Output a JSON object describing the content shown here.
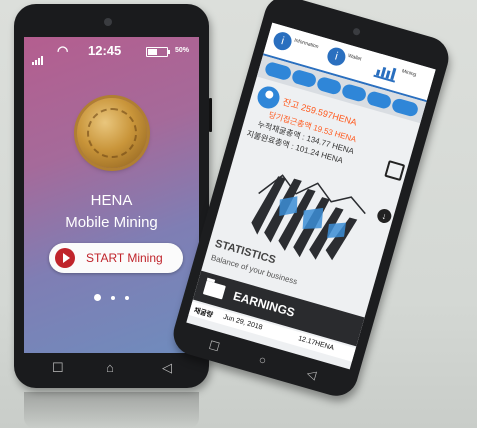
{
  "phone1": {
    "status": {
      "time": "12:45",
      "battery_pct": "50%",
      "battery_level": 0.5
    },
    "app_name_line1": "HENA",
    "app_name_line2": "Mobile Mining",
    "start_button_label": "START Mining",
    "pager": {
      "count": 3,
      "active": 0
    },
    "nav": {
      "recent": "☐",
      "home": "⌂",
      "back": "◁"
    }
  },
  "phone2": {
    "topbar": [
      {
        "icon": "i",
        "label": "Information"
      },
      {
        "icon": "i",
        "label": "Wallet"
      },
      {
        "icon": "",
        "label": "Mining"
      }
    ],
    "tabs": [
      "",
      "",
      "",
      "",
      "",
      ""
    ],
    "balance_label": "잔고",
    "balance_value": "259.597HENA",
    "info_rows": [
      {
        "label": "당기접근총액",
        "value": "19.53 HENA"
      },
      {
        "label": "누적채굴총액",
        "value": ": 134.77 HENA"
      },
      {
        "label": "지불완료총액",
        "value": ": 101.24 HENA"
      }
    ],
    "badge_icon": "↓",
    "statistics_title": "STATISTICS",
    "statistics_subtitle": "Balance of your business",
    "earnings_title": "EARNINGS",
    "earnings_row": {
      "label": "채굴량",
      "date": "Jun 29, 2018",
      "amount": "12.17HENA"
    },
    "nav": {
      "recent": "☐",
      "home": "○",
      "back": "◁"
    }
  },
  "colors": {
    "accent_red": "#c0242b",
    "accent_blue": "#2f86d8",
    "value_orange": "#ff5a1f"
  }
}
